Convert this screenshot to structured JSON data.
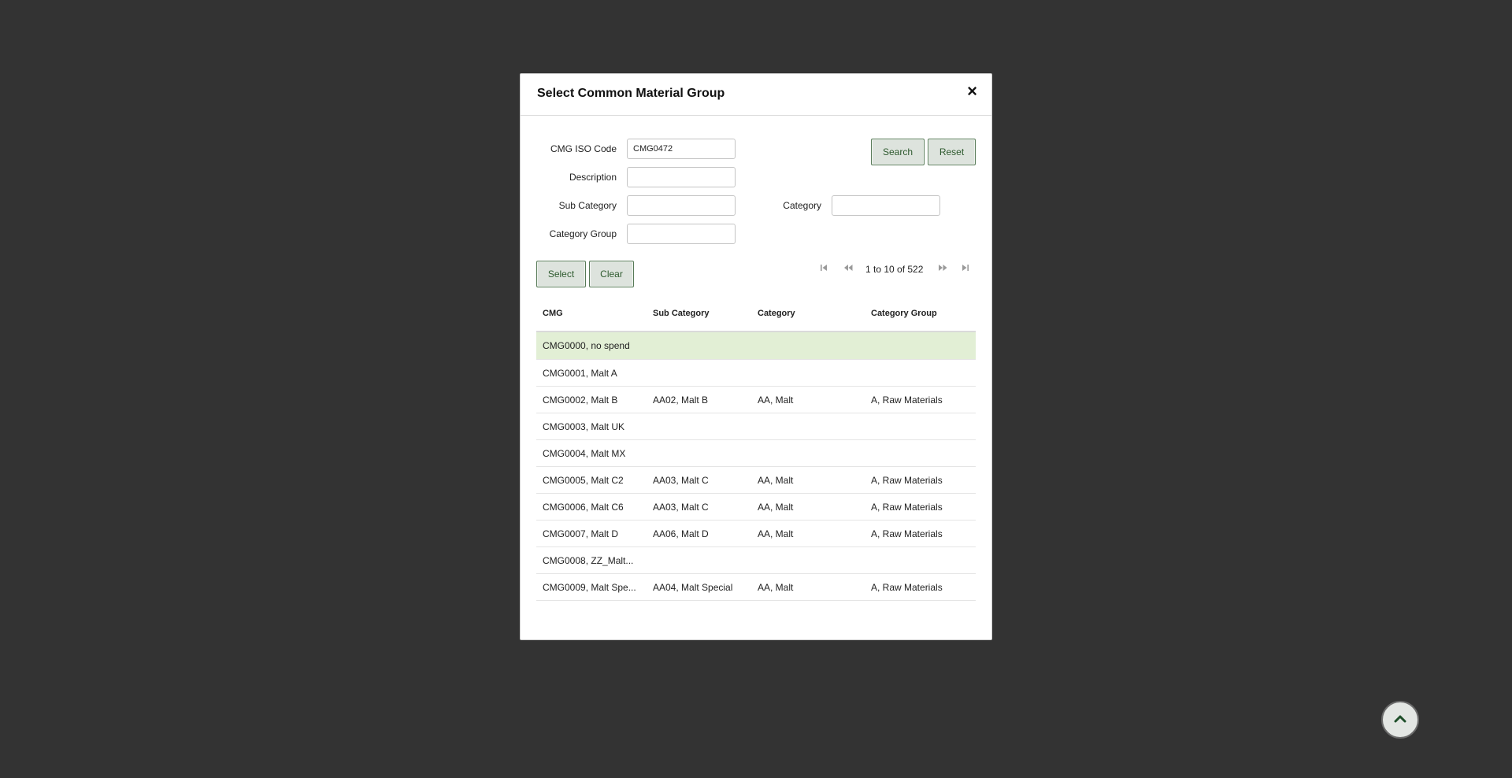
{
  "modal": {
    "title": "Select Common Material Group",
    "close_glyph": "×"
  },
  "form": {
    "iso_code_label": "CMG ISO Code",
    "iso_code_value": "CMG0472",
    "description_label": "Description",
    "description_value": "",
    "sub_category_label": "Sub Category",
    "sub_category_value": "",
    "category_label": "Category",
    "category_value": "",
    "category_group_label": "Category Group",
    "category_group_value": "",
    "search_label": "Search",
    "reset_label": "Reset",
    "select_label": "Select",
    "clear_label": "Clear"
  },
  "pager": {
    "text": "1 to 10 of 522",
    "first_icon": "first-page-icon",
    "prev_icon": "previous-page-icon",
    "next_icon": "next-page-icon",
    "last_icon": "last-page-icon"
  },
  "grid": {
    "headers": [
      "CMG",
      "Sub Category",
      "Category",
      "Category Group"
    ],
    "rows": [
      {
        "cmg": "CMG0000, no spend",
        "sub": "",
        "cat": "",
        "group": "",
        "selected": true
      },
      {
        "cmg": "CMG0001, Malt A",
        "sub": "",
        "cat": "",
        "group": ""
      },
      {
        "cmg": "CMG0002, Malt B",
        "sub": "AA02, Malt B",
        "cat": "AA, Malt",
        "group": "A, Raw Materials"
      },
      {
        "cmg": "CMG0003, Malt UK",
        "sub": "",
        "cat": "",
        "group": ""
      },
      {
        "cmg": "CMG0004, Malt MX",
        "sub": "",
        "cat": "",
        "group": ""
      },
      {
        "cmg": "CMG0005, Malt C2",
        "sub": "AA03, Malt C",
        "cat": "AA, Malt",
        "group": "A, Raw Materials"
      },
      {
        "cmg": "CMG0006, Malt C6",
        "sub": "AA03, Malt C",
        "cat": "AA, Malt",
        "group": "A, Raw Materials"
      },
      {
        "cmg": "CMG0007, Malt D",
        "sub": "AA06, Malt D",
        "cat": "AA, Malt",
        "group": "A, Raw Materials"
      },
      {
        "cmg": "CMG0008, ZZ_Malt...",
        "sub": "",
        "cat": "",
        "group": ""
      },
      {
        "cmg": "CMG0009, Malt Spe...",
        "sub": "AA04, Malt Special",
        "cat": "AA, Malt",
        "group": "A, Raw Materials"
      }
    ]
  },
  "scroll_top": {
    "icon": "chevron-up-icon"
  },
  "colors": {
    "backdrop": "#333333",
    "button_border": "#577a57",
    "button_text": "#2e5a2e",
    "selected_row": "#e2efd5"
  }
}
